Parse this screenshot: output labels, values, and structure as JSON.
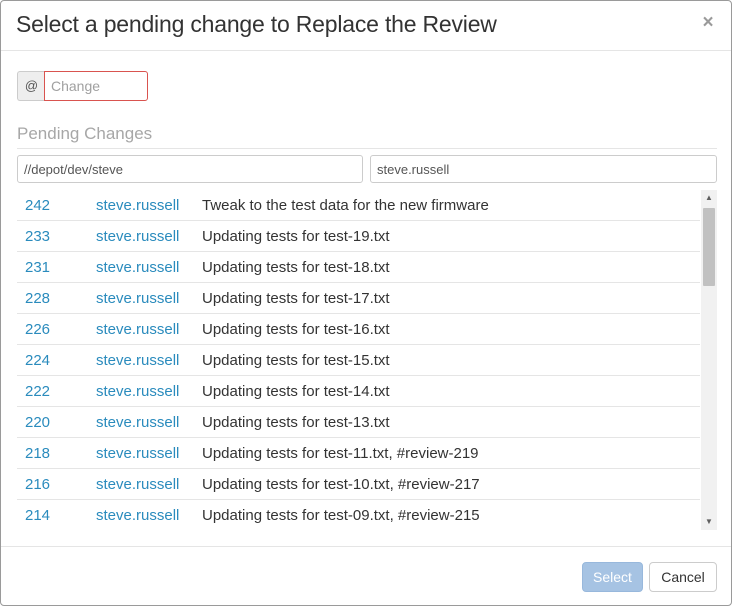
{
  "dialog": {
    "title": "Select a pending change to Replace the Review",
    "close_label": "×"
  },
  "change_field": {
    "addon": "@",
    "placeholder": "Change",
    "value": ""
  },
  "section_title": "Pending Changes",
  "filters": {
    "path": "//depot/dev/steve",
    "user": "steve.russell"
  },
  "changes": [
    {
      "id": "242",
      "user": "steve.russell",
      "description": "Tweak to the test data for the new firmware"
    },
    {
      "id": "233",
      "user": "steve.russell",
      "description": "Updating tests for test-19.txt"
    },
    {
      "id": "231",
      "user": "steve.russell",
      "description": "Updating tests for test-18.txt"
    },
    {
      "id": "228",
      "user": "steve.russell",
      "description": "Updating tests for test-17.txt"
    },
    {
      "id": "226",
      "user": "steve.russell",
      "description": "Updating tests for test-16.txt"
    },
    {
      "id": "224",
      "user": "steve.russell",
      "description": "Updating tests for test-15.txt"
    },
    {
      "id": "222",
      "user": "steve.russell",
      "description": "Updating tests for test-14.txt"
    },
    {
      "id": "220",
      "user": "steve.russell",
      "description": "Updating tests for test-13.txt"
    },
    {
      "id": "218",
      "user": "steve.russell",
      "description": "Updating tests for test-11.txt, #review-219"
    },
    {
      "id": "216",
      "user": "steve.russell",
      "description": "Updating tests for test-10.txt, #review-217"
    },
    {
      "id": "214",
      "user": "steve.russell",
      "description": "Updating tests for test-09.txt, #review-215"
    }
  ],
  "footer": {
    "select_label": "Select",
    "cancel_label": "Cancel"
  },
  "colors": {
    "link": "#2a8bbd",
    "invalid_border": "#d9534f",
    "select_button_disabled": "#a6c3e3"
  },
  "icons": {
    "close": "close-icon",
    "scroll_up": "scroll-up-arrow-icon",
    "scroll_down": "scroll-down-arrow-icon"
  }
}
